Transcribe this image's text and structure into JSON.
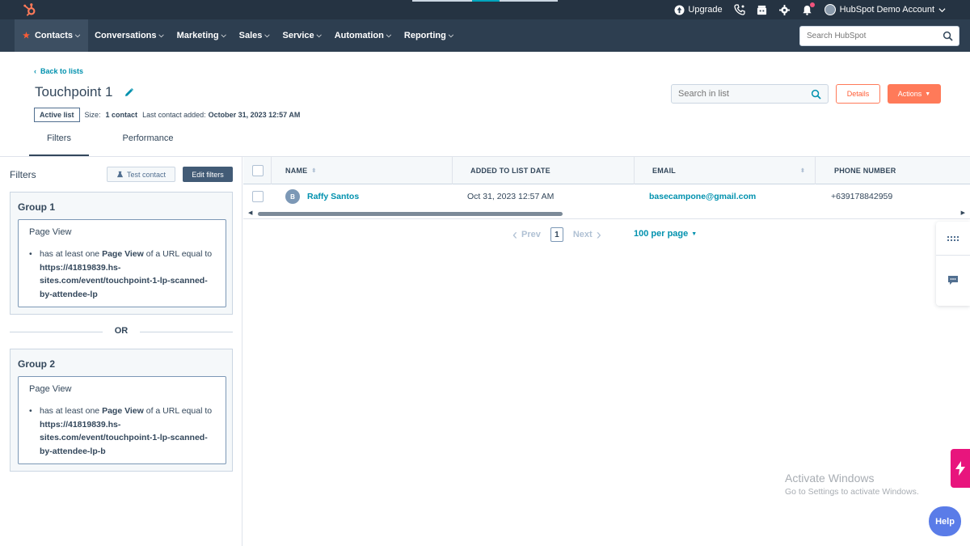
{
  "topbar": {
    "upgrade_label": "Upgrade",
    "account_name": "HubSpot Demo Account",
    "icons": [
      "hubspot-logo-icon",
      "upgrade-icon",
      "phone-icon",
      "marketplace-icon",
      "settings-icon",
      "notifications-icon"
    ]
  },
  "nav": {
    "items": [
      {
        "label": "Contacts"
      },
      {
        "label": "Conversations"
      },
      {
        "label": "Marketing"
      },
      {
        "label": "Sales"
      },
      {
        "label": "Service"
      },
      {
        "label": "Automation"
      },
      {
        "label": "Reporting"
      }
    ],
    "search_placeholder": "Search HubSpot"
  },
  "header": {
    "back_label": "Back to lists",
    "title": "Touchpoint 1",
    "badge": "Active list",
    "size_label": "Size:",
    "size_value": "1 contact",
    "last_added_label": "Last contact added:",
    "last_added_value": "October 31, 2023 12:57 AM",
    "list_search_placeholder": "Search in list",
    "details_label": "Details",
    "actions_label": "Actions"
  },
  "tabs": [
    {
      "label": "Filters"
    },
    {
      "label": "Performance"
    }
  ],
  "filters": {
    "title": "Filters",
    "test_contact_label": "Test contact",
    "edit_filters_label": "Edit filters",
    "or_label": "OR",
    "groups": [
      {
        "title": "Group 1",
        "filter_title": "Page View",
        "text_pre": "has at least one ",
        "text_bold": "Page View",
        "text_mid": " of a URL equal to ",
        "url": "https://41819839.hs-sites.com/event/touchpoint-1-lp-scanned-by-attendee-lp"
      },
      {
        "title": "Group 2",
        "filter_title": "Page View",
        "text_pre": "has at least one ",
        "text_bold": "Page View",
        "text_mid": " of a URL equal to ",
        "url": "https://41819839.hs-sites.com/event/touchpoint-1-lp-scanned-by-attendee-lp-b"
      }
    ]
  },
  "table": {
    "columns": [
      "NAME",
      "ADDED TO LIST DATE",
      "EMAIL",
      "PHONE NUMBER"
    ],
    "rows": [
      {
        "avatar_initial": "B",
        "name": "Raffy Santos",
        "added": "Oct 31, 2023 12:57 AM",
        "email": "basecampone@gmail.com",
        "phone": "+639178842959"
      }
    ]
  },
  "pagination": {
    "prev_label": "Prev",
    "current_page": "1",
    "next_label": "Next",
    "per_page_label": "100 per page"
  },
  "watermark": {
    "line1": "Activate Windows",
    "line2": "Go to Settings to activate Windows."
  },
  "help_label": "Help",
  "colors": {
    "topbar": "#2d3e50",
    "accent_orange": "#ff7a59",
    "link_teal": "#0091ae",
    "bolt_pink": "#e8157d",
    "help_blue": "#5a7ce8"
  }
}
